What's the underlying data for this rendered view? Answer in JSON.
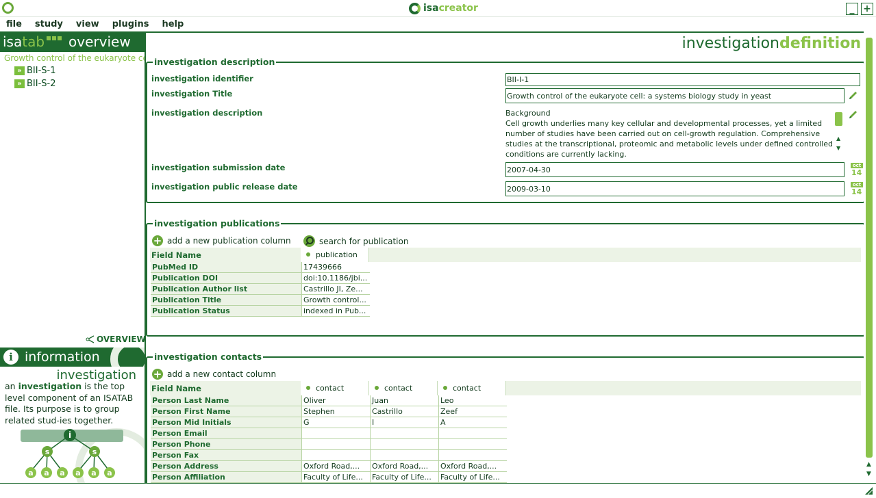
{
  "app": {
    "title_isa": "isa",
    "title_creator": "creator",
    "minimize_label": "_",
    "maximize_label": "+"
  },
  "menu": [
    "file",
    "study",
    "view",
    "plugins",
    "help"
  ],
  "left_panel": {
    "brand_isa": "isa",
    "brand_tab": "tab",
    "header": "overview",
    "tree": {
      "root": "Growth control of the eukaryote cell: a systems biology study in yeast",
      "children": [
        "BII-S-1",
        "BII-S-2"
      ]
    },
    "overview_link": "OVERVIEW",
    "info_title": "information",
    "info_subtitle": "investigation",
    "info_text_pre": "an ",
    "info_text_bold": "investigation",
    "info_text_post": " is the top level component of an ISATAB file. Its purpose is to group related stud-ies together.",
    "diagram_labels": {
      "root": "i",
      "study": "s",
      "assay": "a"
    }
  },
  "main": {
    "title_plain": "investigation",
    "title_bold": "definition",
    "description_section": {
      "title": "investigation description",
      "identifier_label": "investigation identifier",
      "identifier_value": "BII-I-1",
      "title_label": "investigation Title",
      "title_value": "Growth control of the eukaryote cell: a systems biology study in yeast",
      "description_label": "investigation description",
      "description_value": "Background\nCell growth underlies many key cellular and developmental processes, yet a limited number of studies have been carried out on cell-growth regulation. Comprehensive studies at the transcriptional, proteomic and metabolic levels under defined controlled conditions are currently lacking.",
      "submission_label": "investigation submission date",
      "submission_value": "2007-04-30",
      "release_label": "investigation public release date",
      "release_value": "2009-03-10",
      "calendar_month": "oct",
      "calendar_day": "14"
    },
    "publications_section": {
      "title": "investigation publications",
      "add_label": "add a new publication column",
      "search_label": "search for publication",
      "field_name_header": "Field Name",
      "column_header": "publication",
      "rows": [
        {
          "label": "PubMed ID",
          "value": "17439666"
        },
        {
          "label": "Publication DOI",
          "value": "doi:10.1186/jbi..."
        },
        {
          "label": "Publication Author list",
          "value": "Castrillo JI, Ze..."
        },
        {
          "label": "Publication Title",
          "value": "Growth control..."
        },
        {
          "label": "Publication Status",
          "value": "indexed in Pub..."
        }
      ]
    },
    "contacts_section": {
      "title": "investigation contacts",
      "add_label": "add a new contact column",
      "field_name_header": "Field Name",
      "column_headers": [
        "contact",
        "contact",
        "contact"
      ],
      "rows": [
        {
          "label": "Person Last Name",
          "values": [
            "Oliver",
            "Juan",
            "Leo"
          ]
        },
        {
          "label": "Person First Name",
          "values": [
            "Stephen",
            "Castrillo",
            "Zeef"
          ]
        },
        {
          "label": "Person Mid Initials",
          "values": [
            "G",
            "I",
            "A"
          ]
        },
        {
          "label": "Person Email",
          "values": [
            "",
            "",
            ""
          ]
        },
        {
          "label": "Person Phone",
          "values": [
            "",
            "",
            ""
          ]
        },
        {
          "label": "Person Fax",
          "values": [
            "",
            "",
            ""
          ]
        },
        {
          "label": "Person Address",
          "values": [
            "Oxford Road,...",
            "Oxford Road,...",
            "Oxford Road,..."
          ]
        },
        {
          "label": "Person Affiliation",
          "values": [
            "Faculty of Life...",
            "Faculty of Life...",
            "Faculty of Life..."
          ]
        }
      ]
    }
  },
  "colors": {
    "dark_green": "#1f6a30",
    "light_green": "#8bc34a",
    "row_bg": "#ecf3e6"
  }
}
